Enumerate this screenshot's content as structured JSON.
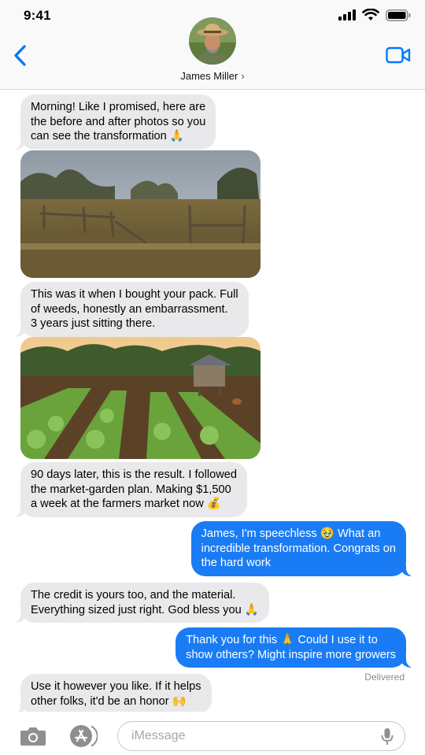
{
  "status_bar": {
    "time": "9:41"
  },
  "header": {
    "contact_name": "James Miller",
    "chevron": "›"
  },
  "messages": [
    {
      "direction": "in",
      "text": "Morning! Like I promised, here are\nthe before and after photos so you\ncan see the transformation 🙏"
    },
    {
      "direction": "in",
      "type": "photo",
      "icon": "before-photo-overgrown-field"
    },
    {
      "direction": "in",
      "text": "This was it when I bought your pack. Full\nof weeds, honestly an embarrassment.\n3 years just sitting there."
    },
    {
      "direction": "in",
      "type": "photo",
      "icon": "after-photo-vegetable-garden"
    },
    {
      "direction": "in",
      "text": "90 days later, this is the result. I followed\nthe market-garden plan. Making $1,500\na week at the farmers market now 💰"
    },
    {
      "direction": "out",
      "text": "James, I'm speechless 🥹 What an\nincredible transformation. Congrats on\nthe hard work"
    },
    {
      "direction": "in",
      "text": "The credit is yours too, and the material.\nEverything sized just right. God bless you 🙏"
    },
    {
      "direction": "out",
      "text": "Thank you for this 🙏 Could I use it to\nshow others? Might inspire more growers"
    },
    {
      "direction": "in",
      "text": "Use it however you like. If it helps\nother folks, it'd be an honor 🙌"
    }
  ],
  "delivered_label": "Delivered",
  "composer": {
    "placeholder": "iMessage"
  },
  "colors": {
    "outgoing_bubble": "#1a7cf5",
    "incoming_bubble": "#e9e9eb",
    "accent": "#007aff"
  }
}
